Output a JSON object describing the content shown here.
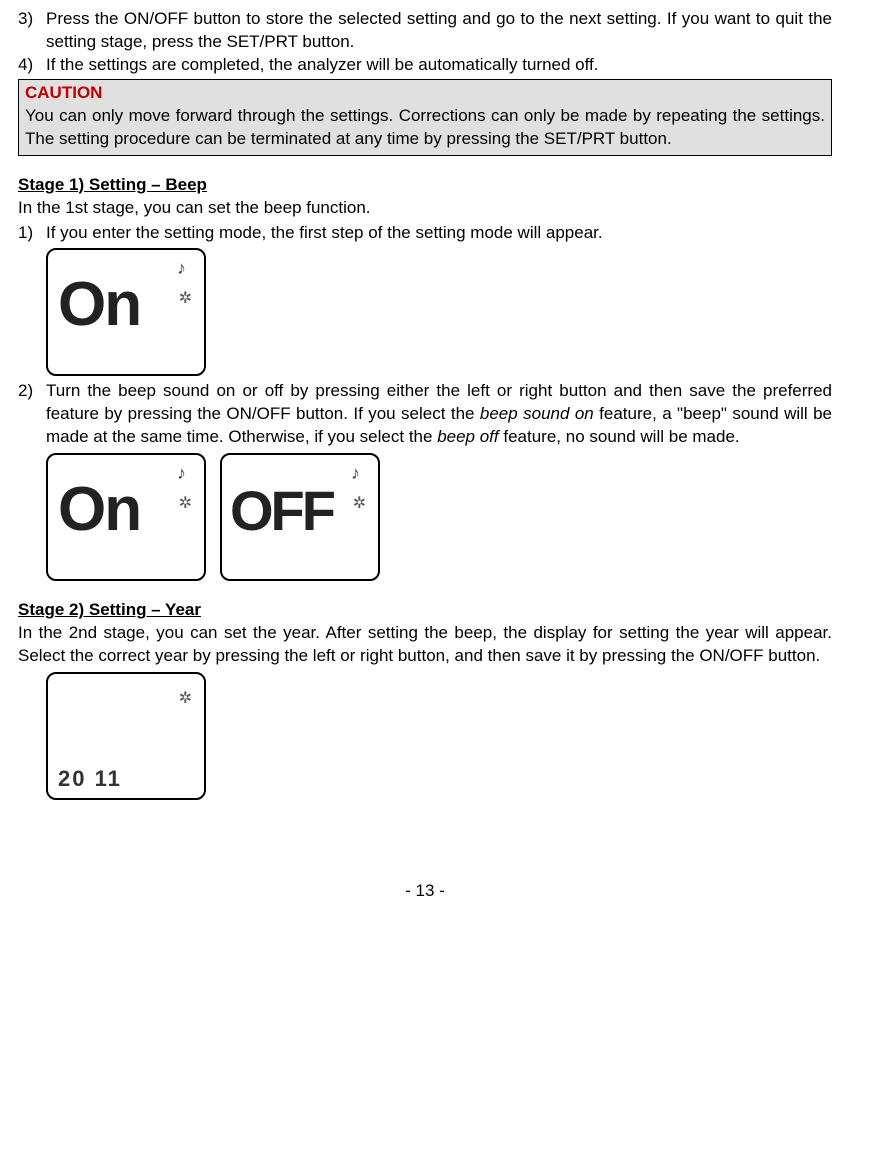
{
  "items": {
    "n3_num": "3)",
    "n3_text_a": "Press the ON/OFF button to store the selected setting and go to the next setting. If you want to quit the setting stage, press the SET/PRT button.",
    "n4_num": "4)",
    "n4_text": "If the settings are completed, the analyzer will be automatically turned off."
  },
  "caution": {
    "title": "CAUTION",
    "body": "You can only move forward through the settings. Corrections can only be made by repeating the settings. The setting procedure can be terminated at any time by pressing the SET/PRT button."
  },
  "stage1": {
    "heading": "Stage 1) Setting – Beep",
    "intro": "In the 1st stage, you can set the beep function.",
    "s1_num": "1)",
    "s1_text": "If you enter the setting mode, the first step of the setting mode will appear.",
    "s2_num": "2)",
    "s2_text_a": "Turn the beep sound on or off by pressing either the left or right button and then save the preferred feature by pressing the ON/OFF button. If you select the ",
    "s2_em1": "beep sound on",
    "s2_text_b": " feature, a \"beep\" sound will be made at the same time. Otherwise, if you select the ",
    "s2_em2": "beep off",
    "s2_text_c": " feature, no sound will be made."
  },
  "stage2": {
    "heading": "Stage 2) Setting – Year",
    "body": "In the 2nd stage, you can set the year. After setting the beep, the display for setting the year will appear. Select the correct year by pressing the left or right button, and then save it by pressing the ON/OFF button."
  },
  "lcd": {
    "on": "On",
    "off": "OFF",
    "year": "20 11",
    "note": "♪",
    "gear": "✲",
    "blink": "\\  |  /"
  },
  "footer": "- 13 -"
}
